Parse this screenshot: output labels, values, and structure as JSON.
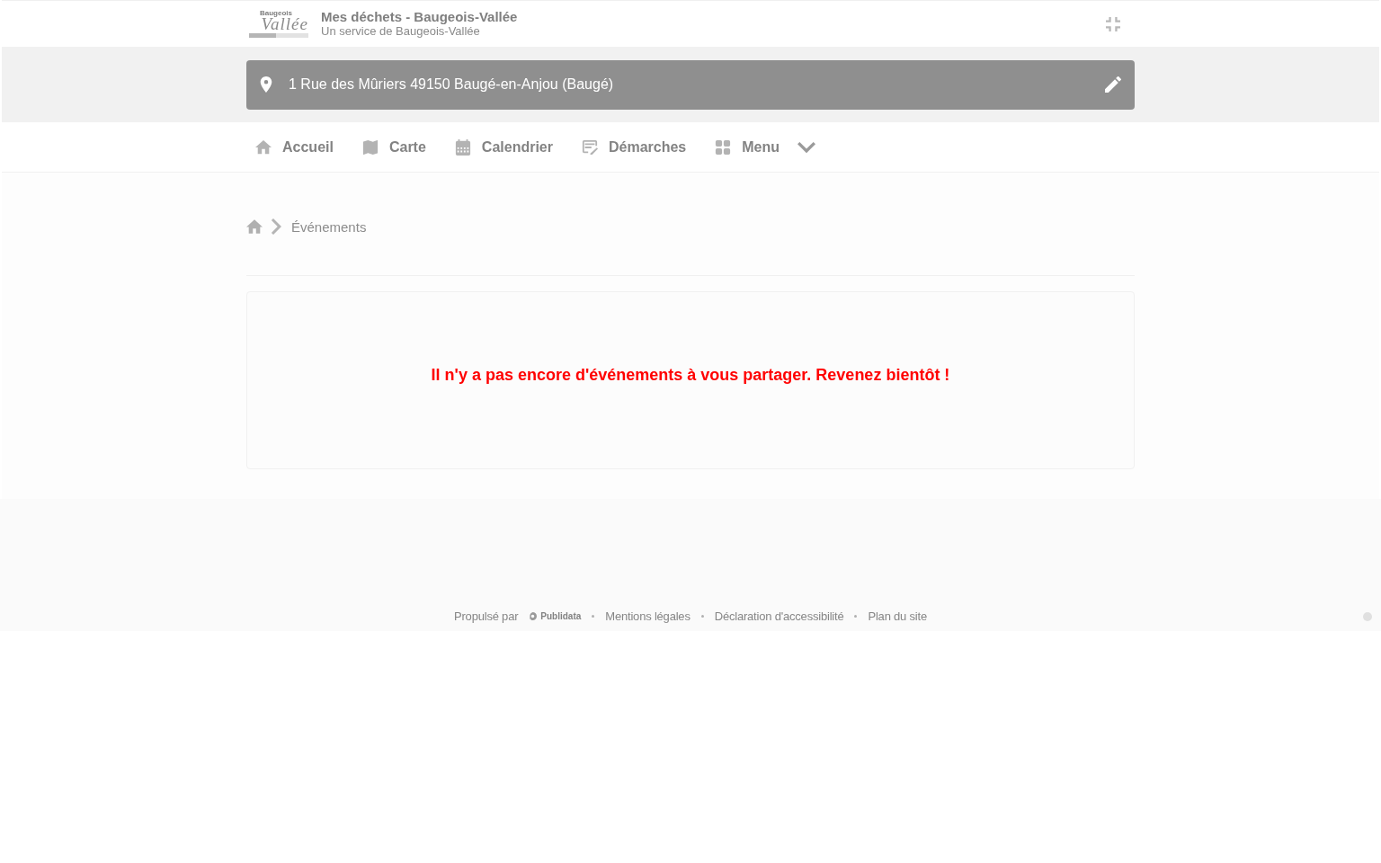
{
  "header": {
    "logo": {
      "line_1": "Baugeois",
      "line_2": "Vallée"
    },
    "title": "Mes déchets - Baugeois-Vallée",
    "subtitle": "Un service de Baugeois-Vallée"
  },
  "address": {
    "value": "1 Rue des Mûriers 49150 Baugé-en-Anjou (Baugé)"
  },
  "nav": [
    {
      "kind": "home",
      "label": "Accueil",
      "dropdown": false
    },
    {
      "kind": "map",
      "label": "Carte",
      "dropdown": false
    },
    {
      "kind": "calendar",
      "label": "Calendrier",
      "dropdown": false
    },
    {
      "kind": "form",
      "label": "Démarches",
      "dropdown": false
    },
    {
      "kind": "grid",
      "label": "Menu",
      "dropdown": true
    }
  ],
  "breadcrumb": {
    "current": "Événements"
  },
  "empty_message": "Il n'y a pas encore d'événements à vous partager. Revenez bientôt !",
  "footer": {
    "powered_by": "Propulsé par",
    "brand": "Publidata",
    "links": [
      "Mentions légales",
      "Déclaration d'accessibilité",
      "Plan du site"
    ]
  }
}
